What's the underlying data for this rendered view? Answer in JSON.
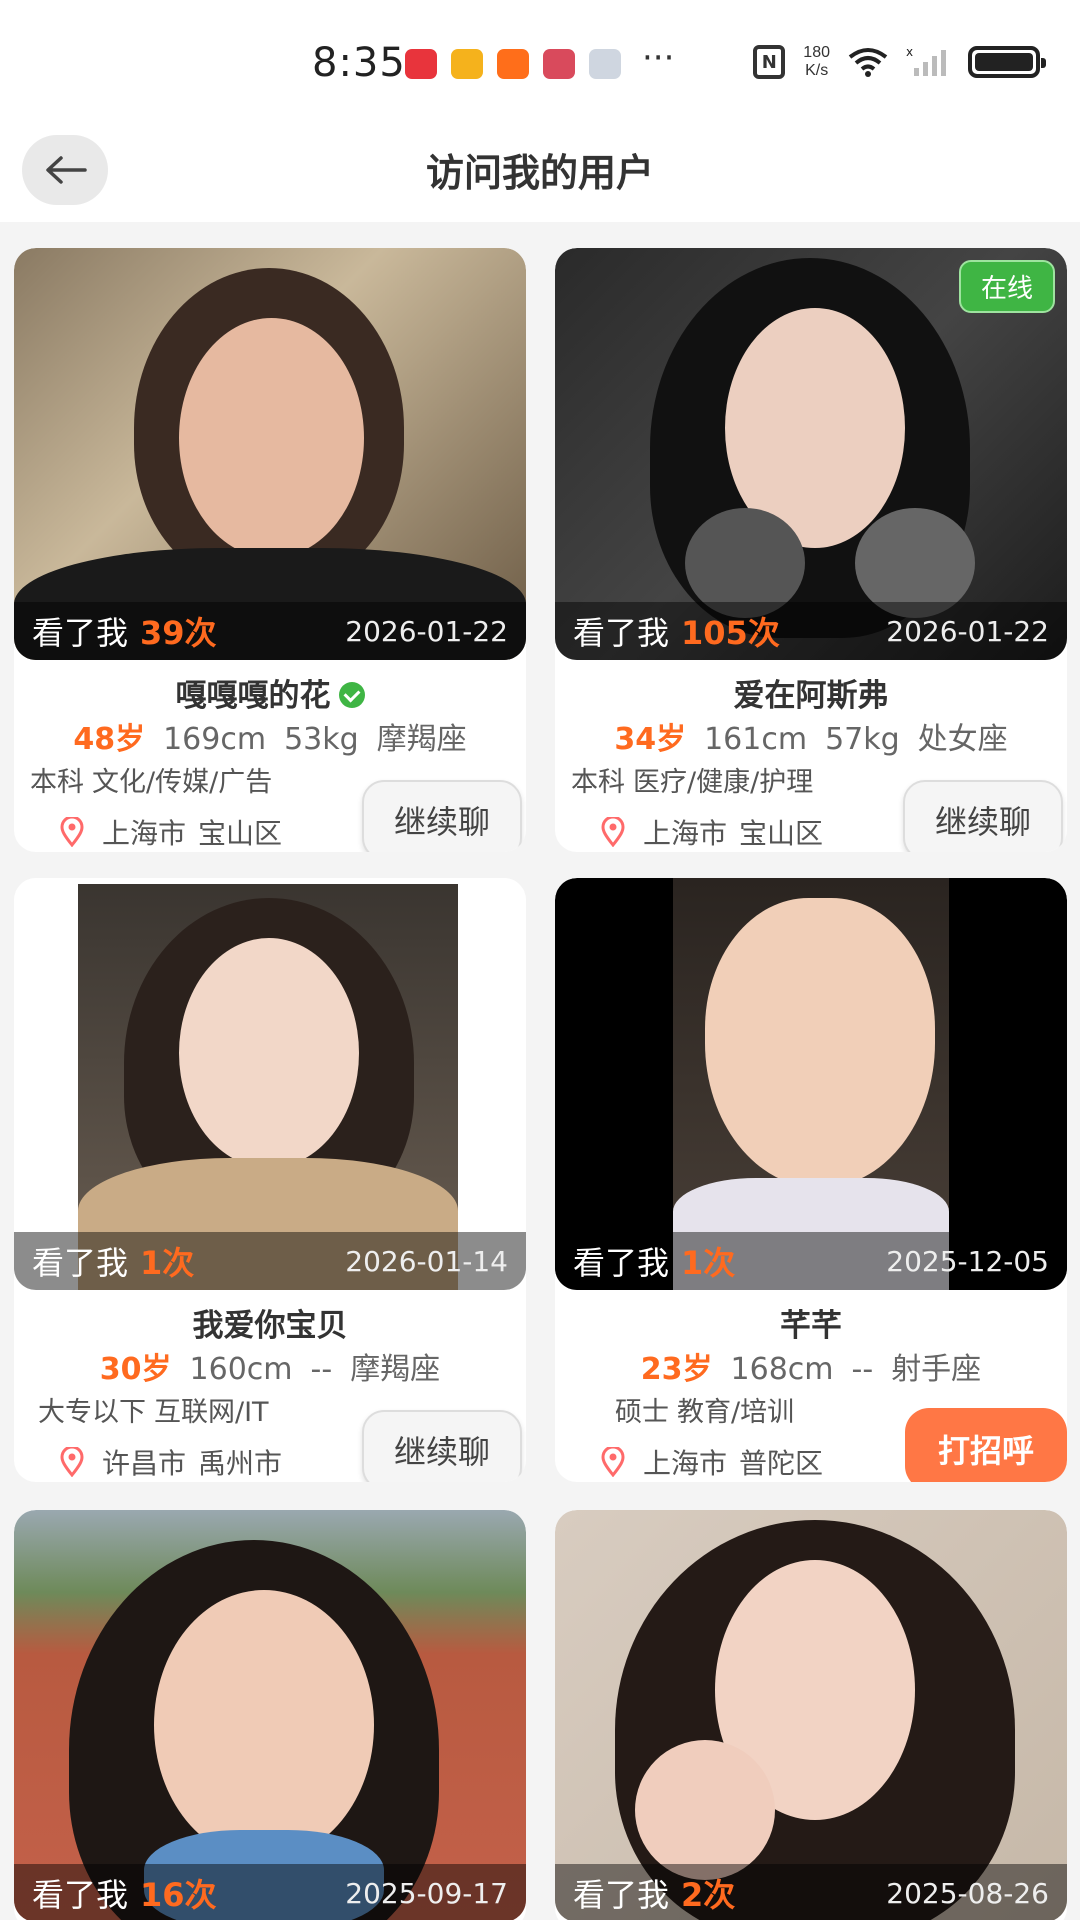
{
  "status_bar": {
    "time": "8:35",
    "more": "···",
    "nfc": "N",
    "net_speed_value": "180",
    "net_speed_unit": "K/s"
  },
  "header": {
    "back_icon": "arrow-left-icon",
    "title": "访问我的用户"
  },
  "labels": {
    "visited_me": "看了我",
    "continue_chat": "继续聊",
    "say_hi": "打招呼",
    "online": "在线"
  },
  "users": [
    {
      "name": "嘎嘎嘎的花",
      "verified": true,
      "online": false,
      "visit_count": "39次",
      "visit_date": "2026-01-22",
      "age": "48岁",
      "height": "169cm",
      "weight": "53kg",
      "zodiac": "摩羯座",
      "education": "本科",
      "industry": "文化/传媒/广告",
      "city": "上海市",
      "district": "宝山区",
      "action": "继续聊"
    },
    {
      "name": "爱在阿斯弗",
      "verified": false,
      "online": true,
      "visit_count": "105次",
      "visit_date": "2026-01-22",
      "age": "34岁",
      "height": "161cm",
      "weight": "57kg",
      "zodiac": "处女座",
      "education": "本科",
      "industry": "医疗/健康/护理",
      "city": "上海市",
      "district": "宝山区",
      "action": "继续聊"
    },
    {
      "name": "我爱你宝贝",
      "verified": false,
      "online": false,
      "visit_count": "1次",
      "visit_date": "2026-01-14",
      "age": "30岁",
      "height": "160cm",
      "weight": "--",
      "zodiac": "摩羯座",
      "education": "大专以下",
      "industry": "互联网/IT",
      "city": "许昌市",
      "district": "禹州市",
      "action": "继续聊"
    },
    {
      "name": "芊芊",
      "verified": false,
      "online": false,
      "visit_count": "1次",
      "visit_date": "2025-12-05",
      "age": "23岁",
      "height": "168cm",
      "weight": "--",
      "zodiac": "射手座",
      "education": "硕士",
      "industry": "教育/培训",
      "city": "上海市",
      "district": "普陀区",
      "action": "打招呼"
    },
    {
      "name": "",
      "visit_count": "16次",
      "visit_date": "2025-09-17"
    },
    {
      "name": "",
      "visit_count": "2次",
      "visit_date": "2025-08-26"
    }
  ],
  "colors": {
    "accent_orange": "#ff6a1f",
    "greet_button": "#ff7745",
    "online_green": "#3fb544",
    "page_bg": "#f4f4f4"
  }
}
